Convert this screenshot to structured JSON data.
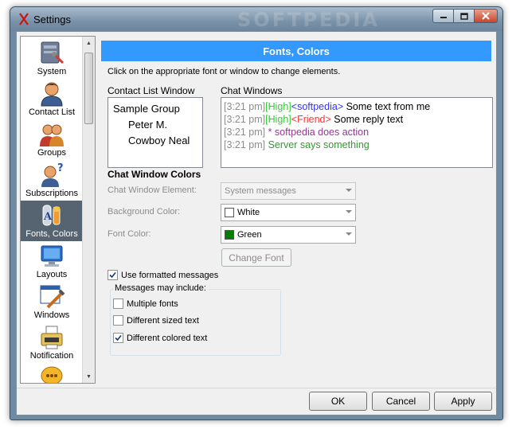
{
  "window": {
    "title": "Settings",
    "watermark": "SOFTPEDIA"
  },
  "sidebar": {
    "items": [
      {
        "label": "System",
        "icon": "system-icon",
        "selected": false
      },
      {
        "label": "Contact List",
        "icon": "contact-list-icon",
        "selected": false
      },
      {
        "label": "Groups",
        "icon": "groups-icon",
        "selected": false
      },
      {
        "label": "Subscriptions",
        "icon": "subscriptions-icon",
        "selected": false
      },
      {
        "label": "Fonts, Colors",
        "icon": "fonts-colors-icon",
        "selected": true
      },
      {
        "label": "Layouts",
        "icon": "layouts-icon",
        "selected": false
      },
      {
        "label": "Windows",
        "icon": "windows-icon",
        "selected": false
      },
      {
        "label": "Notification",
        "icon": "notification-icon",
        "selected": false
      },
      {
        "label": "",
        "icon": "chat-bubble-icon",
        "selected": false
      }
    ]
  },
  "panel": {
    "title": "Fonts, Colors",
    "instruction": "Click on the appropriate font or window to change elements.",
    "contact_list_label": "Contact List Window",
    "contact_list": {
      "group": "Sample Group",
      "contacts": [
        "Peter M.",
        "Cowboy Neal"
      ]
    },
    "chat_windows_label": "Chat Windows",
    "chat_lines": [
      {
        "time": "[3:21 pm]",
        "priority": "[High]",
        "nick": "<softpedia>",
        "text": " Some text from me"
      },
      {
        "time": "[3:21 pm]",
        "priority": "[High]",
        "nick": "<Friend>",
        "text": " Some reply text"
      },
      {
        "time": "[3:21 pm]",
        "action": " * softpedia does action"
      },
      {
        "time": "[3:21 pm]",
        "server": " Server says something"
      }
    ],
    "chat_colors_label": "Chat Window Colors",
    "element_label": "Chat Window Element:",
    "element_value": "System messages",
    "background_label": "Background Color:",
    "background_value": "White",
    "background_swatch": "#ffffff",
    "font_color_label": "Font Color:",
    "font_color_value": "Green",
    "font_color_swatch": "#008000",
    "change_font_label": "Change Font",
    "use_formatted_label": "Use formatted messages",
    "use_formatted_checked": true,
    "messages_group_label": "Messages may include:",
    "options": [
      {
        "label": "Multiple fonts",
        "checked": false
      },
      {
        "label": "Different sized text",
        "checked": false
      },
      {
        "label": "Different colored text",
        "checked": true
      }
    ]
  },
  "buttons": {
    "ok": "OK",
    "cancel": "Cancel",
    "apply": "Apply"
  },
  "colors": {
    "header_blue": "#3399ff",
    "selected_item": "#566370",
    "high_priority": "#33cc33",
    "self_nick": "#3333ff",
    "friend_nick": "#ff3333",
    "action": "#993399",
    "server": "#339933"
  }
}
